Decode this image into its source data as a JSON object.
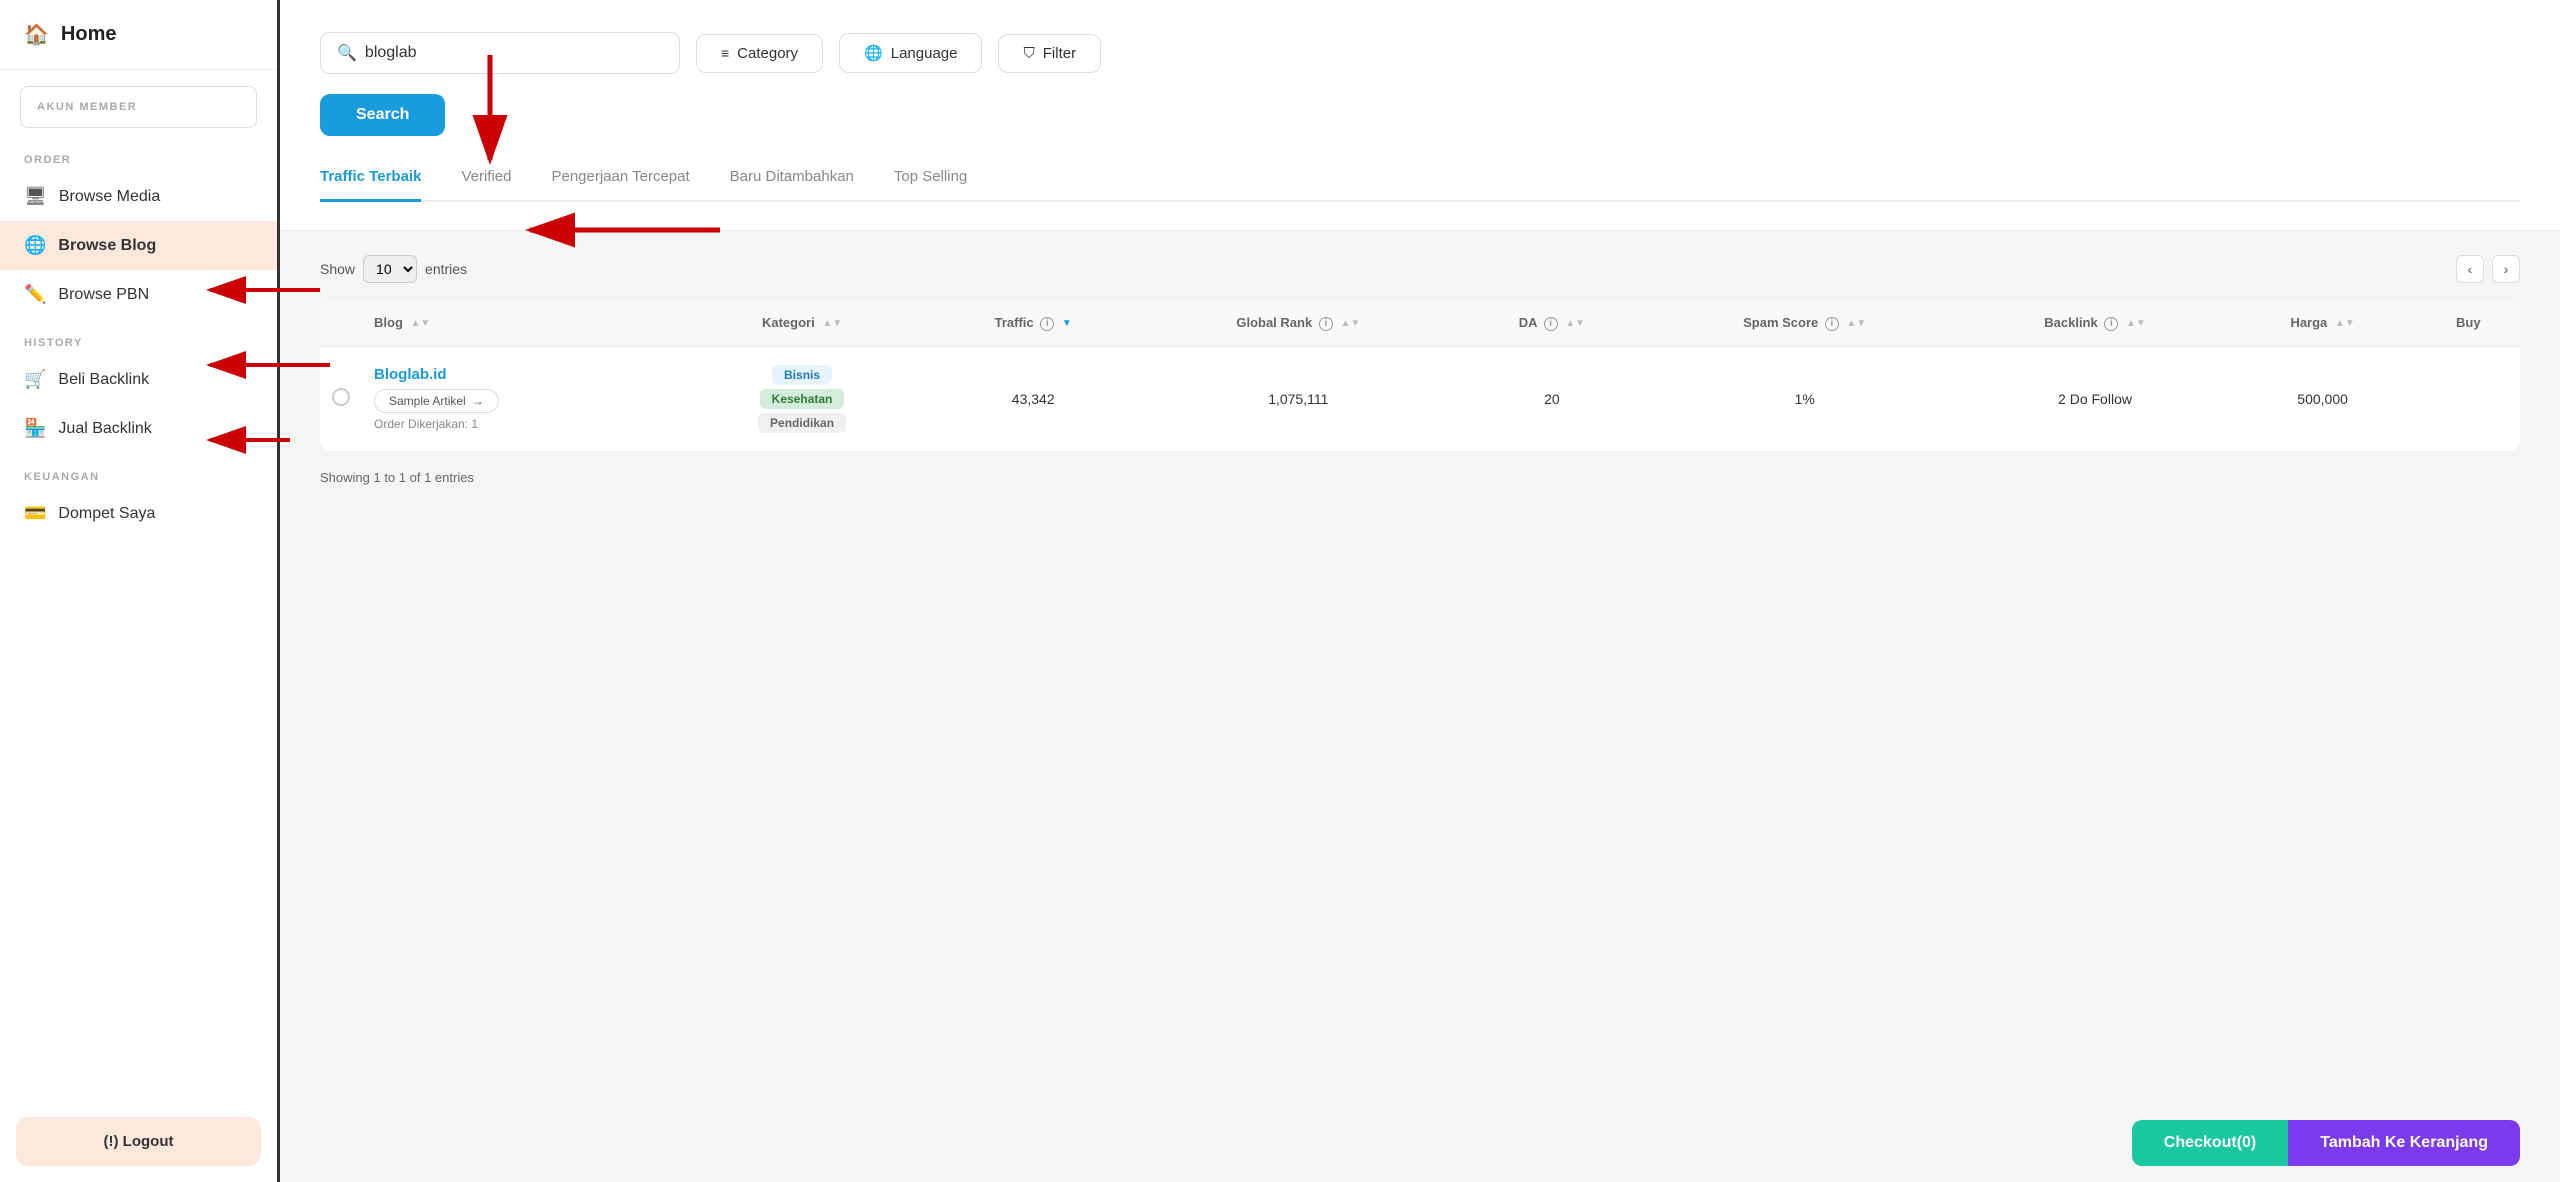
{
  "sidebar": {
    "home_label": "Home",
    "account_section": "AKUN MEMBER",
    "order_section": "ORDER",
    "browse_media_label": "Browse Media",
    "browse_blog_label": "Browse Blog",
    "browse_pbn_label": "Browse PBN",
    "history_section": "HISTORY",
    "beli_backlink_label": "Beli Backlink",
    "jual_backlink_label": "Jual Backlink",
    "keuangan_section": "KEUANGAN",
    "dompet_label": "Dompet Saya",
    "logout_label": "(!) Logout"
  },
  "search": {
    "placeholder": "bloglab",
    "category_label": "Category",
    "language_label": "Language",
    "filter_label": "Filter",
    "search_label": "Search"
  },
  "tabs": [
    {
      "label": "Traffic Terbaik",
      "active": true
    },
    {
      "label": "Verified",
      "active": false
    },
    {
      "label": "Pengerjaan Tercepat",
      "active": false
    },
    {
      "label": "Baru Ditambahkan",
      "active": false
    },
    {
      "label": "Top Selling",
      "active": false
    }
  ],
  "table": {
    "show_label": "Show",
    "entries_label": "entries",
    "show_value": "10",
    "columns": {
      "blog": "Blog",
      "kategori": "Kategori",
      "traffic": "Traffic",
      "global_rank": "Global Rank",
      "da": "DA",
      "spam_score": "Spam Score",
      "backlink": "Backlink",
      "harga": "Harga",
      "buy": "Buy"
    },
    "rows": [
      {
        "name": "Bloglab.id",
        "sample_label": "Sample Artikel",
        "order_label": "Order Dikerjakan: 1",
        "tags": [
          "Bisnis",
          "Kesehatan",
          "Pendidikan"
        ],
        "traffic": "43,342",
        "global_rank": "1,075,111",
        "da": "20",
        "spam_score": "1%",
        "backlink": "2 Do Follow",
        "harga": "500,000"
      }
    ],
    "pagination_label": "Showing 1 to 1 of 1 entries"
  },
  "bottom": {
    "checkout_label": "Checkout(0)",
    "keranjang_label": "Tambah Ke Keranjang"
  }
}
